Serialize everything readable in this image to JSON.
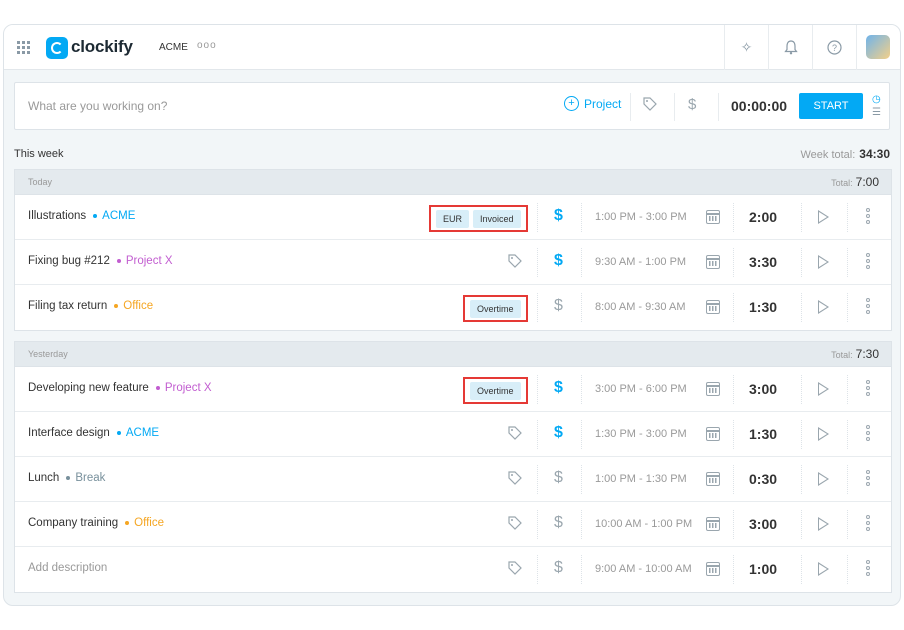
{
  "header": {
    "logo_text": "clockify",
    "workspace": "ACME",
    "workspace_menu": "ooo"
  },
  "timer": {
    "placeholder": "What are you working on?",
    "project_label": "Project",
    "clock": "00:00:00",
    "start_label": "START"
  },
  "week": {
    "title": "This week",
    "total_label": "Week total:",
    "total_value": "34:30"
  },
  "groups": [
    {
      "label": "Today",
      "total_label": "Total:",
      "total_value": "7:00",
      "entries": [
        {
          "description": "Illustrations",
          "project": "ACME",
          "project_color": "#03a9f4",
          "tags": [
            "EUR",
            "Invoiced"
          ],
          "billable": true,
          "time_range": "1:00 PM - 3:00 PM",
          "duration": "2:00"
        },
        {
          "description": "Fixing bug #212",
          "project": "Project X",
          "project_color": "#c25dd0",
          "tags": [],
          "billable": true,
          "time_range": "9:30 AM - 1:00 PM",
          "duration": "3:30"
        },
        {
          "description": "Filing tax return",
          "project": "Office",
          "project_color": "#f5a623",
          "tags": [
            "Overtime"
          ],
          "billable": false,
          "time_range": "8:00 AM - 9:30 AM",
          "duration": "1:30"
        }
      ]
    },
    {
      "label": "Yesterday",
      "total_label": "Total:",
      "total_value": "7:30",
      "entries": [
        {
          "description": "Developing new feature",
          "project": "Project X",
          "project_color": "#c25dd0",
          "tags": [
            "Overtime"
          ],
          "billable": true,
          "time_range": "3:00 PM - 6:00 PM",
          "duration": "3:00"
        },
        {
          "description": "Interface design",
          "project": "ACME",
          "project_color": "#03a9f4",
          "tags": [],
          "billable": true,
          "time_range": "1:30 PM - 3:00 PM",
          "duration": "1:30"
        },
        {
          "description": "Lunch",
          "project": "Break",
          "project_color": "#78909c",
          "tags": [],
          "billable": false,
          "time_range": "1:00 PM - 1:30 PM",
          "duration": "0:30"
        },
        {
          "description": "Company training",
          "project": "Office",
          "project_color": "#f5a623",
          "tags": [],
          "billable": false,
          "time_range": "10:00 AM - 1:00 PM",
          "duration": "3:00"
        },
        {
          "description": "Add description",
          "project": "",
          "project_color": "",
          "tags": [],
          "billable": false,
          "time_range": "9:00 AM - 10:00 AM",
          "duration": "1:00"
        }
      ]
    }
  ],
  "colors": {
    "accent": "#03a9f4",
    "highlight_border": "#e53935",
    "icon_gray": "#9aa6ae"
  }
}
